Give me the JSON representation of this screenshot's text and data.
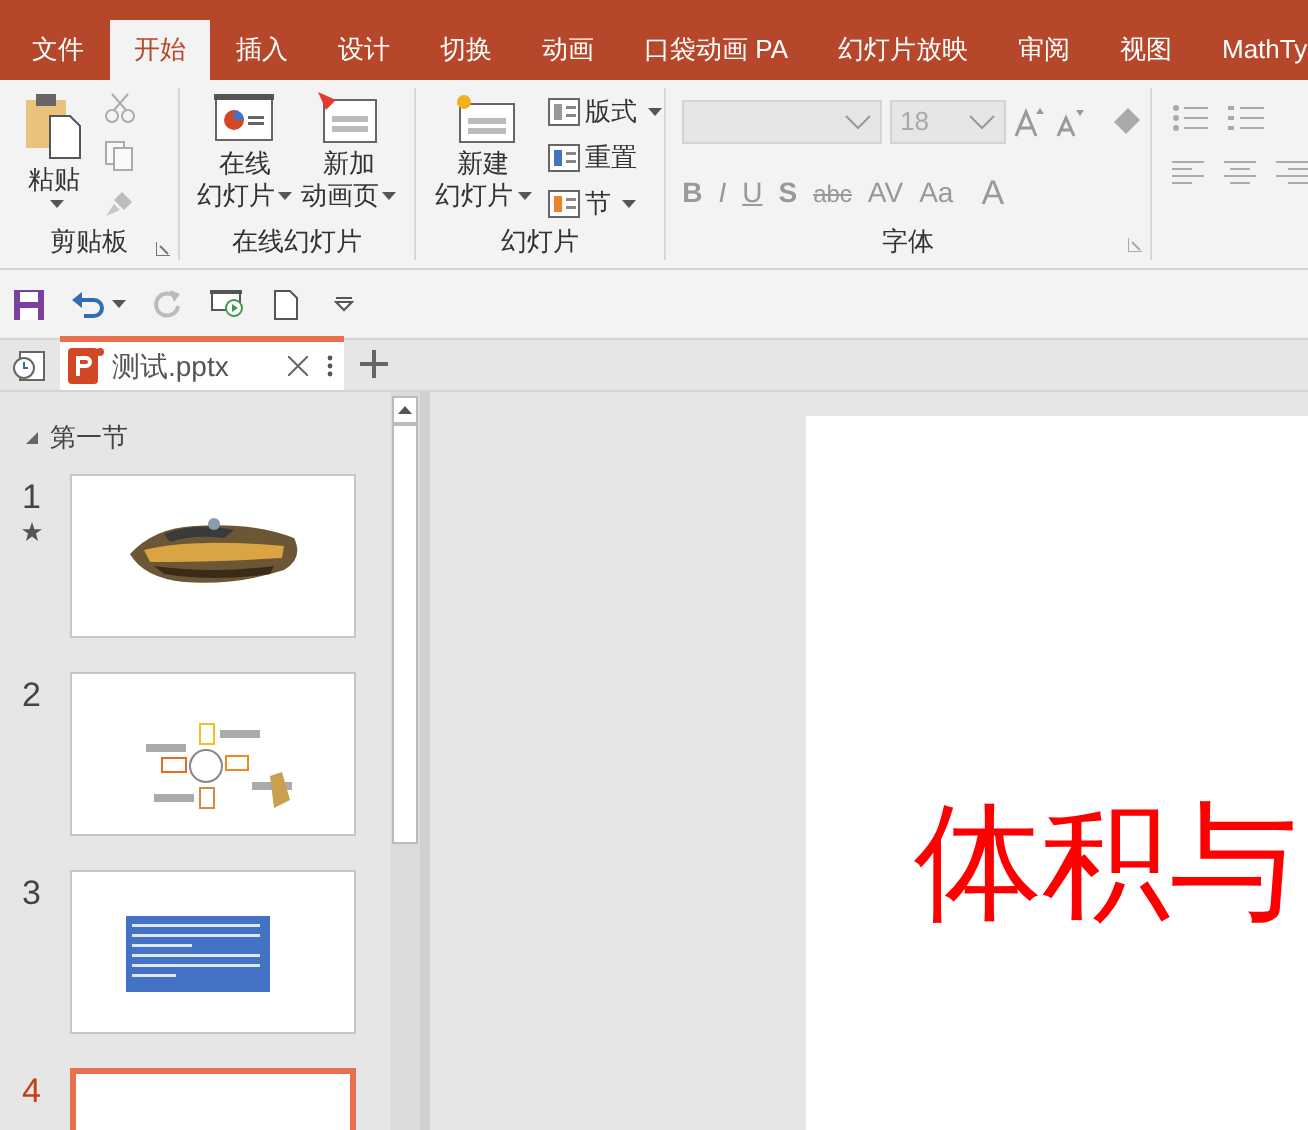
{
  "tabs": [
    {
      "label": "文件",
      "selected": false
    },
    {
      "label": "开始",
      "selected": true
    },
    {
      "label": "插入",
      "selected": false
    },
    {
      "label": "设计",
      "selected": false
    },
    {
      "label": "切换",
      "selected": false
    },
    {
      "label": "动画",
      "selected": false
    },
    {
      "label": "口袋动画 PA",
      "selected": false
    },
    {
      "label": "幻灯片放映",
      "selected": false
    },
    {
      "label": "审阅",
      "selected": false
    },
    {
      "label": "视图",
      "selected": false
    },
    {
      "label": "MathTy",
      "selected": false
    }
  ],
  "ribbon": {
    "clipboard": {
      "paste": "粘贴",
      "label": "剪贴板"
    },
    "online": {
      "buttons": [
        {
          "line1": "在线",
          "line2": "幻灯片"
        },
        {
          "line1": "新加",
          "line2": "动画页"
        }
      ],
      "label": "在线幻灯片"
    },
    "slides": {
      "new_slide": {
        "line1": "新建",
        "line2": "幻灯片"
      },
      "small_buttons": [
        {
          "label": "版式",
          "dropdown": true
        },
        {
          "label": "重置",
          "dropdown": false
        },
        {
          "label": "节",
          "dropdown": true
        }
      ],
      "label": "幻灯片"
    },
    "font": {
      "size": "18",
      "format_buttons": [
        "B",
        "I",
        "U",
        "S",
        "abc",
        "AV",
        "Aa",
        "A"
      ],
      "label": "字体"
    }
  },
  "document_tab": {
    "title": "测试.pptx"
  },
  "section": {
    "title": "第一节"
  },
  "slides": [
    {
      "number": "1",
      "kind": "picture",
      "animated": true,
      "selected": false
    },
    {
      "number": "2",
      "kind": "diagram",
      "animated": false,
      "selected": false
    },
    {
      "number": "3",
      "kind": "text",
      "animated": false,
      "selected": false
    },
    {
      "number": "4",
      "kind": "blank",
      "animated": false,
      "selected": true
    }
  ],
  "canvas": {
    "text": "体积与"
  }
}
